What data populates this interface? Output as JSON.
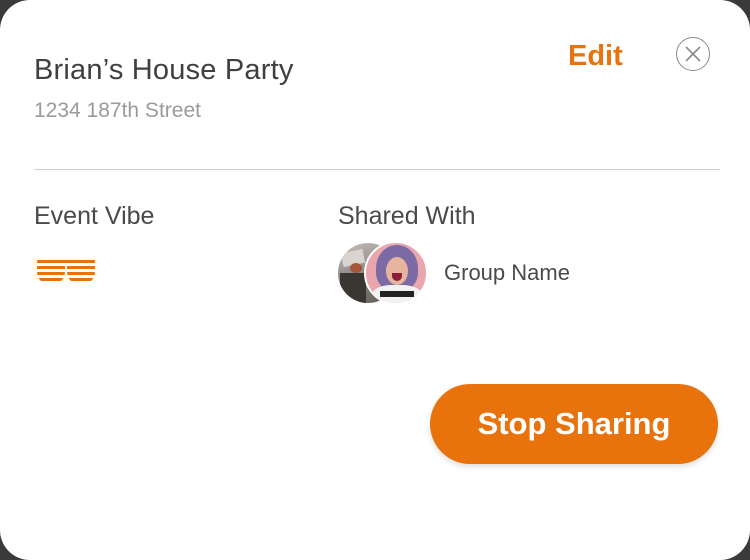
{
  "event": {
    "title": "Brian’s House Party",
    "address": "1234 187th Street"
  },
  "header": {
    "edit_label": "Edit",
    "close_icon": "close-circle-icon"
  },
  "event_vibe": {
    "label": "Event Vibe",
    "icon": "shutter-shades-icon"
  },
  "shared_with": {
    "label": "Shared With",
    "group_name": "Group Name",
    "avatar_icons": [
      "group-avatar-photo",
      "member-avatar-photo"
    ]
  },
  "actions": {
    "stop_sharing_label": "Stop Sharing"
  },
  "colors": {
    "accent": "#e8730c",
    "text_primary": "#3f3f3f",
    "text_secondary": "#9a9a9a",
    "background": "#ffffff",
    "divider": "#cfcfcf"
  }
}
